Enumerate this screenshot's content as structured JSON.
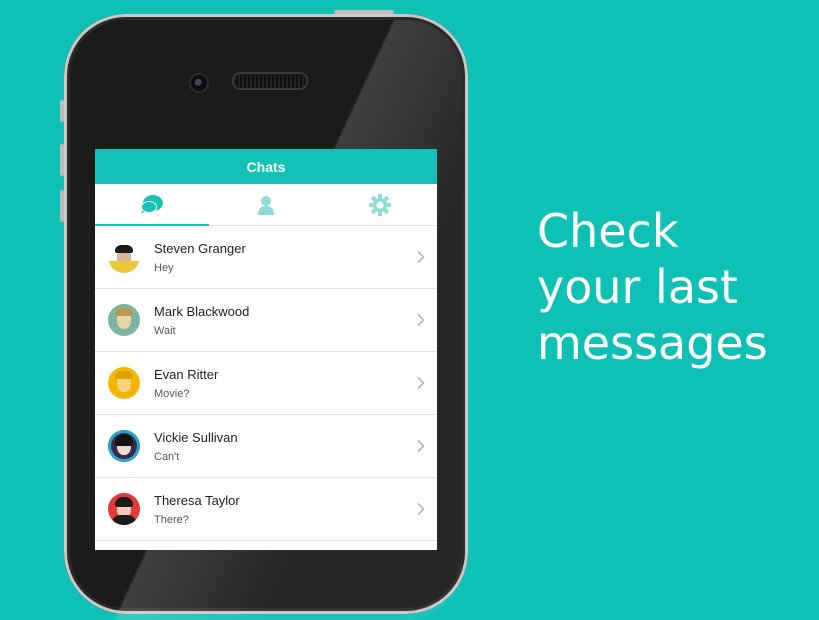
{
  "navbar": {
    "title": "Chats"
  },
  "tabs": [
    {
      "icon": "chat-bubbles-icon",
      "active": true
    },
    {
      "icon": "person-icon",
      "active": false
    },
    {
      "icon": "gear-icon",
      "active": false
    }
  ],
  "chats": [
    {
      "name": "Steven Granger",
      "message": "Hey",
      "avatar_color": "#ffffff"
    },
    {
      "name": "Mark Blackwood",
      "message": "Wait",
      "avatar_color": "#7fb3a4"
    },
    {
      "name": "Evan Ritter",
      "message": "Movie?",
      "avatar_color": "#f5b400"
    },
    {
      "name": "Vickie Sullivan",
      "message": "Can't",
      "avatar_color": "#3b2b4a"
    },
    {
      "name": "Theresa Taylor",
      "message": "There?",
      "avatar_color": "#e23a3a"
    }
  ],
  "promo": {
    "line1": "Check",
    "line2": "your last",
    "line3": "messages"
  },
  "colors": {
    "accent": "#14c2b5",
    "background": "#0fc1b5"
  }
}
